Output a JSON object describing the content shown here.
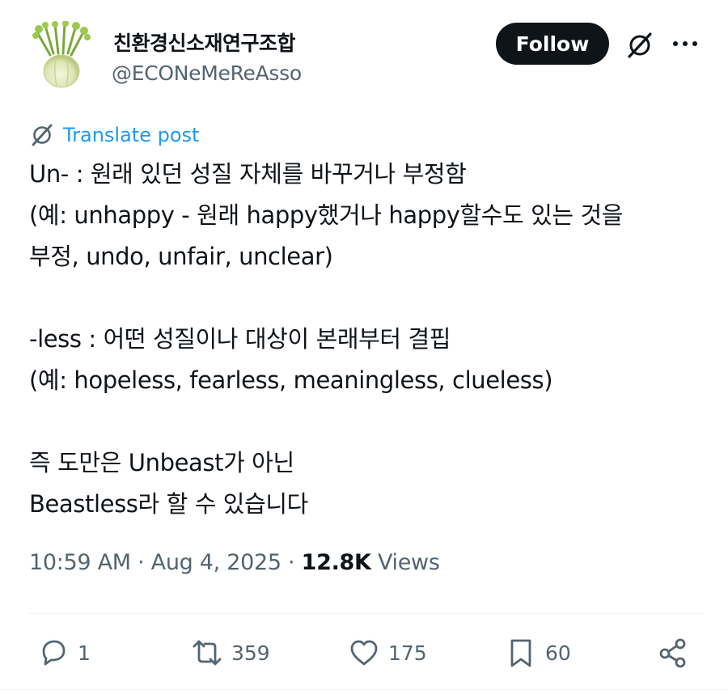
{
  "author": {
    "display_name": "친환경신소재연구조합",
    "handle": "@ECONeMeReAsso",
    "avatar_icon": "fennel-avatar"
  },
  "header": {
    "follow_label": "Follow",
    "grok_icon": "grok-icon",
    "more_icon": "more-dots-icon"
  },
  "translate": {
    "label": "Translate post",
    "icon": "translate-icon"
  },
  "tweet": {
    "lines": [
      "Un- : 원래 있던 성질 자체를 바꾸거나 부정함",
      "(예: unhappy - 원래 happy했거나 happy할수도 있는 것을",
      "부정, undo, unfair, unclear)",
      "",
      "-less : 어떤 성질이나 대상이 본래부터 결핍",
      "(예: hopeless, fearless, meaningless, clueless)",
      "",
      "즉 도만은 Unbeast가 아닌",
      "Beastless라 할 수 있습니다"
    ]
  },
  "meta": {
    "time": "10:59 AM",
    "separator": "·",
    "date": "Aug 4, 2025",
    "views_count": "12.8K",
    "views_label": "Views"
  },
  "actions": {
    "replies": "1",
    "reposts": "359",
    "likes": "175",
    "bookmarks": "60"
  },
  "colors": {
    "text": "#0f1419",
    "secondary": "#536471",
    "link": "#1d9bf0",
    "button_bg": "#0f1419"
  }
}
